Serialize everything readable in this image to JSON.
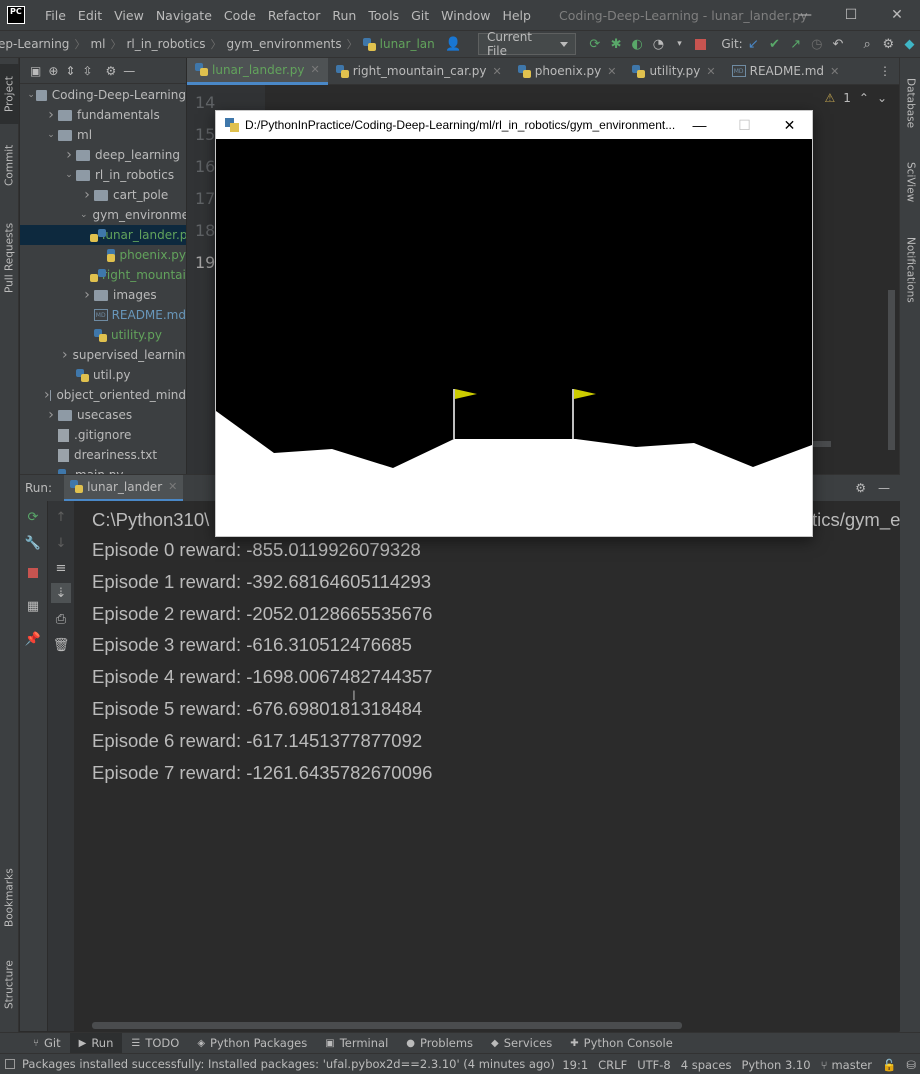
{
  "titlebar": {
    "app_logo": "PC",
    "menu": [
      "File",
      "Edit",
      "View",
      "Navigate",
      "Code",
      "Refactor",
      "Run",
      "Tools",
      "Git",
      "Window",
      "Help"
    ],
    "window_title": "Coding-Deep-Learning - lunar_lander.py",
    "minimize": "—",
    "maximize": "☐",
    "close": "✕"
  },
  "navbar": {
    "breadcrumbs": [
      "ep-Learning",
      "ml",
      "rl_in_robotics",
      "gym_environments",
      "lunar_lan"
    ],
    "run_config": "Current File",
    "git_label": "Git:"
  },
  "left_strip": {
    "project": "Project",
    "commit": "Commit",
    "pull_requests": "Pull Requests",
    "bookmarks": "Bookmarks",
    "structure": "Structure"
  },
  "right_strip": {
    "database": "Database",
    "sciview": "SciView",
    "notifications": "Notifications"
  },
  "project_tree": [
    {
      "label": "Coding-Deep-Learning",
      "indent": 0,
      "arrow": "open",
      "icon": "folder",
      "color": "default"
    },
    {
      "label": "fundamentals",
      "indent": 1,
      "arrow": "closed",
      "icon": "folder",
      "color": "default"
    },
    {
      "label": "ml",
      "indent": 1,
      "arrow": "open",
      "icon": "folder",
      "color": "default"
    },
    {
      "label": "deep_learning",
      "indent": 2,
      "arrow": "closed",
      "icon": "folder",
      "color": "default"
    },
    {
      "label": "rl_in_robotics",
      "indent": 2,
      "arrow": "open",
      "icon": "folder",
      "color": "default"
    },
    {
      "label": "cart_pole",
      "indent": 3,
      "arrow": "closed",
      "icon": "folder",
      "color": "default"
    },
    {
      "label": "gym_environments",
      "indent": 3,
      "arrow": "open",
      "icon": "folder",
      "color": "default"
    },
    {
      "label": "lunar_lander.py",
      "indent": 4,
      "arrow": "none",
      "icon": "py",
      "color": "green"
    },
    {
      "label": "phoenix.py",
      "indent": 4,
      "arrow": "none",
      "icon": "py",
      "color": "green"
    },
    {
      "label": "right_mountain_car.py",
      "indent": 4,
      "arrow": "none",
      "icon": "py",
      "color": "green"
    },
    {
      "label": "images",
      "indent": 3,
      "arrow": "closed",
      "icon": "folder",
      "color": "default"
    },
    {
      "label": "README.md",
      "indent": 3,
      "arrow": "none",
      "icon": "md",
      "color": "blue"
    },
    {
      "label": "utility.py",
      "indent": 3,
      "arrow": "none",
      "icon": "py",
      "color": "green"
    },
    {
      "label": "supervised_learning",
      "indent": 2,
      "arrow": "closed",
      "icon": "folder",
      "color": "default"
    },
    {
      "label": "util.py",
      "indent": 2,
      "arrow": "none",
      "icon": "py",
      "color": "default"
    },
    {
      "label": "object_oriented_mind",
      "indent": 1,
      "arrow": "closed",
      "icon": "folder",
      "color": "default"
    },
    {
      "label": "usecases",
      "indent": 1,
      "arrow": "closed",
      "icon": "folder",
      "color": "default"
    },
    {
      "label": ".gitignore",
      "indent": 1,
      "arrow": "none",
      "icon": "file",
      "color": "default"
    },
    {
      "label": "dreariness.txt",
      "indent": 1,
      "arrow": "none",
      "icon": "file",
      "color": "default"
    },
    {
      "label": "main.py",
      "indent": 1,
      "arrow": "none",
      "icon": "py",
      "color": "default"
    }
  ],
  "editor_tabs": [
    {
      "label": "lunar_lander.py",
      "active": true,
      "icon": "py"
    },
    {
      "label": "right_mountain_car.py",
      "active": false,
      "icon": "py"
    },
    {
      "label": "phoenix.py",
      "active": false,
      "icon": "py"
    },
    {
      "label": "utility.py",
      "active": false,
      "icon": "py"
    },
    {
      "label": "README.md",
      "active": false,
      "icon": "md"
    }
  ],
  "editor": {
    "line_numbers": [
      "14",
      "15",
      "16",
      "17",
      "18",
      "19"
    ],
    "inspection_count": "1"
  },
  "run_panel": {
    "label": "Run:",
    "tab": "lunar_lander",
    "command_prefix": "C:\\Python310\\",
    "command_suffix": "tics/gym_e",
    "output": [
      "Episode 0 reward: -855.0119926079328",
      "Episode 1 reward: -392.68164605114293",
      "Episode 2 reward: -2052.0128665535676",
      "Episode 3 reward: -616.310512476685",
      "Episode 4 reward: -1698.0067482744357",
      "Episode 5 reward: -676.6980181318484",
      "Episode 6 reward: -617.1451377877092",
      "Episode 7 reward: -1261.6435782670096"
    ]
  },
  "bottom_tabs": [
    {
      "label": "Git",
      "icon": "⑂",
      "active": false
    },
    {
      "label": "Run",
      "icon": "▶",
      "active": true
    },
    {
      "label": "TODO",
      "icon": "☰",
      "active": false
    },
    {
      "label": "Python Packages",
      "icon": "◈",
      "active": false
    },
    {
      "label": "Terminal",
      "icon": "▣",
      "active": false
    },
    {
      "label": "Problems",
      "icon": "●",
      "active": false
    },
    {
      "label": "Services",
      "icon": "◆",
      "active": false
    },
    {
      "label": "Python Console",
      "icon": "✚",
      "active": false
    }
  ],
  "statusbar": {
    "message": "Packages installed successfully: Installed packages: 'ufal.pybox2d==2.3.10' (4 minutes ago)",
    "position": "19:1",
    "line_sep": "CRLF",
    "encoding": "UTF-8",
    "indent": "4 spaces",
    "interpreter": "Python 3.10",
    "branch": "master"
  },
  "game_window": {
    "title": "D:/PythonInPractice/Coding-Deep-Learning/ml/rl_in_robotics/gym_environment...",
    "minimize": "—",
    "maximize": "☐",
    "close": "✕",
    "colors": {
      "sky": "#000000",
      "ground": "#ffffff",
      "flag": "#cccc00",
      "pole": "#ffffff"
    }
  }
}
